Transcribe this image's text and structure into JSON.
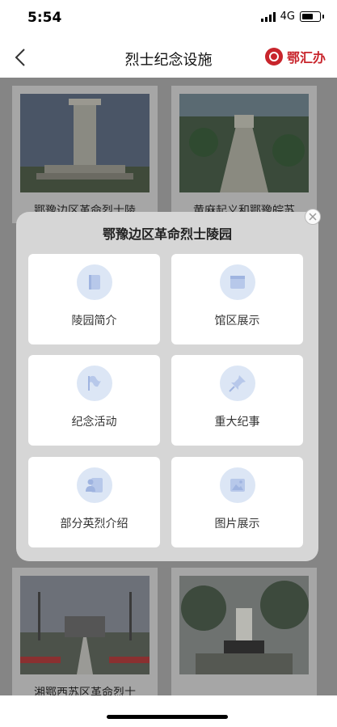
{
  "status": {
    "time": "5:54",
    "network": "4G"
  },
  "header": {
    "title": "烈士纪念设施",
    "brand": "鄂汇办"
  },
  "cards": [
    {
      "label": "鄂豫边区革命烈士陵"
    },
    {
      "label": "黄麻起义和鄂豫皖苏"
    },
    {
      "label": "湘鄂西苏区革命烈士"
    },
    {
      "label": ""
    }
  ],
  "modal": {
    "title": "鄂豫边区革命烈士陵园",
    "items": [
      {
        "label": "陵园简介",
        "icon": "book-icon"
      },
      {
        "label": "馆区展示",
        "icon": "browser-window-icon"
      },
      {
        "label": "纪念活动",
        "icon": "flag-icon"
      },
      {
        "label": "重大纪事",
        "icon": "pin-icon"
      },
      {
        "label": "部分英烈介绍",
        "icon": "person-profile-icon"
      },
      {
        "label": "图片展示",
        "icon": "image-icon"
      }
    ]
  },
  "colors": {
    "brand": "#c8252c",
    "icon_bg": "#dce6f5",
    "icon_fg": "#b7c8ea"
  }
}
